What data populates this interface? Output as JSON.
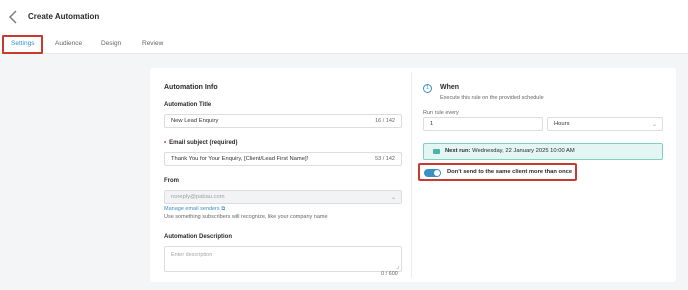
{
  "header": {
    "back_icon": "chevron-left-icon",
    "title": "Create Automation"
  },
  "tabs": [
    {
      "label": "Settings",
      "active": true
    },
    {
      "label": "Audience"
    },
    {
      "label": "Design"
    },
    {
      "label": "Review"
    }
  ],
  "automation_info": {
    "heading": "Automation Info",
    "title_label": "Automation Title",
    "title_value": "New Lead Enquiry",
    "title_counter": "16 / 142",
    "subject_label": "Email subject (required)",
    "subject_value": "Thank You for Your Enquiry, [Client/Lead First Name]!",
    "subject_counter": "53 / 142",
    "from_label": "From",
    "from_value": "noreply@pabau.com",
    "manage_link": "Manage email senders",
    "from_help": "Use something subscribers will recognize, like your company name",
    "description_label": "Automation Description",
    "description_placeholder": "Enter description",
    "description_counter": "0 / 600"
  },
  "when": {
    "step": "1",
    "heading": "When",
    "subtitle": "Execute this rule on the provided schedule",
    "run_label": "Run rule every",
    "run_value": "1",
    "unit_value": "Hours",
    "next_run_label": "Next run:",
    "next_run_value": "Wednesday, 22 January 2025 10:00 AM",
    "toggle_label": "Don't send to the same client more than once",
    "toggle_on": true
  },
  "colors": {
    "accent": "#3a8fc4",
    "highlight": "#c83a2e",
    "next_run_bg": "#e4f6f3"
  }
}
